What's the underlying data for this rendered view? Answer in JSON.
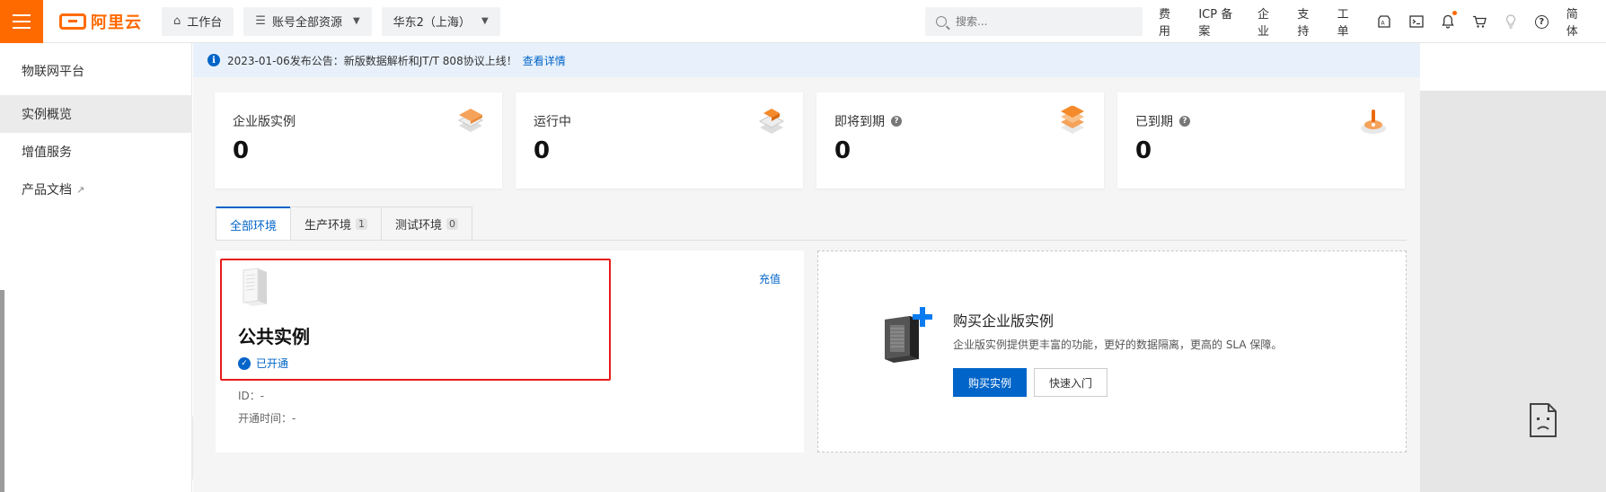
{
  "topbar": {
    "logo_text": "阿里云",
    "workbench": "工作台",
    "resources": "账号全部资源",
    "region": "华东2（上海）",
    "search_placeholder": "搜索...",
    "links": [
      "费用",
      "ICP 备案",
      "企业",
      "支持",
      "工单"
    ],
    "lang": "简体",
    "accent_color": "#ff6a00"
  },
  "sidebar": {
    "title": "物联网平台",
    "items": [
      {
        "label": "实例概览",
        "active": true
      },
      {
        "label": "增值服务",
        "active": false
      },
      {
        "label": "产品文档",
        "active": false,
        "external": true
      }
    ]
  },
  "notice": {
    "text": "2023-01-06发布公告：新版数据解析和JT/T 808协议上线！",
    "link": "查看详情"
  },
  "stats": [
    {
      "label": "企业版实例",
      "value": "0",
      "help": false
    },
    {
      "label": "运行中",
      "value": "0",
      "help": false
    },
    {
      "label": "即将到期",
      "value": "0",
      "help": true
    },
    {
      "label": "已到期",
      "value": "0",
      "help": true
    }
  ],
  "tabs": [
    {
      "label": "全部环境",
      "count": null
    },
    {
      "label": "生产环境",
      "count": "1"
    },
    {
      "label": "测试环境",
      "count": "0"
    }
  ],
  "instance": {
    "title": "公共实例",
    "status": "已开通",
    "recharge": "充值",
    "id_label": "ID：-",
    "time_label": "开通时间：-"
  },
  "buy": {
    "title": "购买企业版实例",
    "desc": "企业版实例提供更丰富的功能，更好的数据隔离，更高的 SLA 保障。",
    "primary": "购买实例",
    "secondary": "快速入门"
  }
}
